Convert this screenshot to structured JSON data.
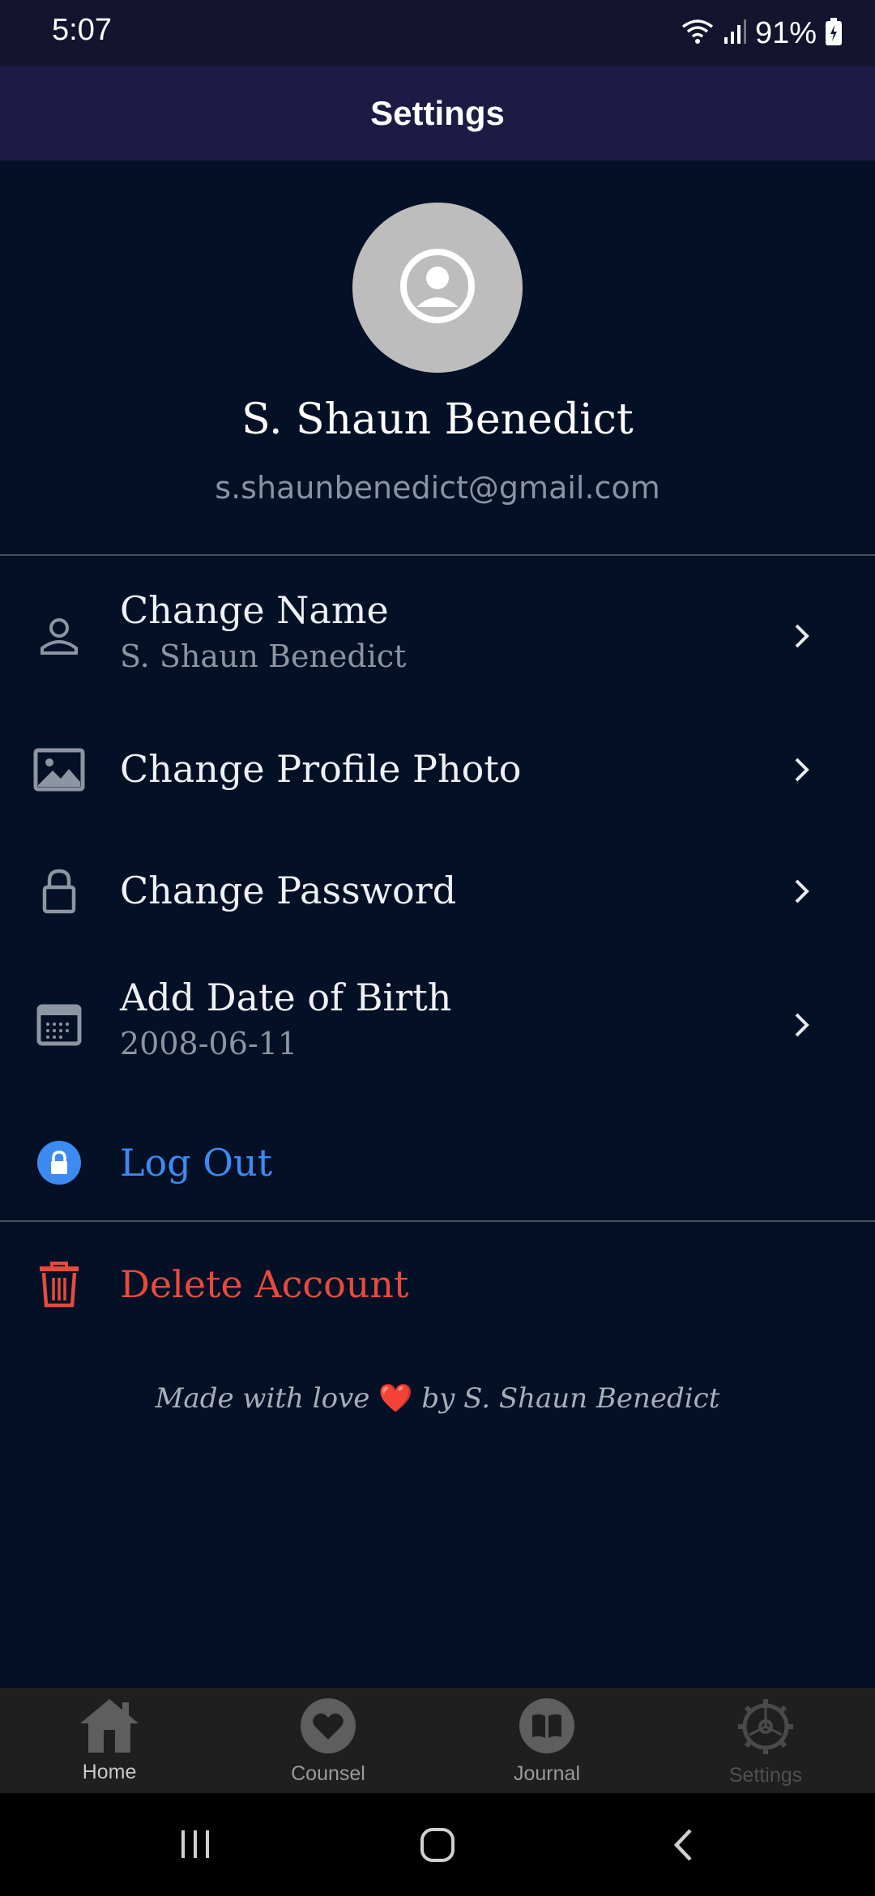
{
  "status_bar": {
    "time": "5:07",
    "battery": "91%"
  },
  "app_bar": {
    "title": "Settings"
  },
  "profile": {
    "name": "S. Shaun Benedict",
    "email": "s.shaunbenedict@gmail.com"
  },
  "settings": {
    "change_name": {
      "title": "Change Name",
      "value": "S. Shaun Benedict",
      "icon": "person-icon"
    },
    "change_photo": {
      "title": "Change Profile Photo",
      "icon": "image-icon"
    },
    "change_password": {
      "title": "Change Password",
      "icon": "lock-icon"
    },
    "date_of_birth": {
      "title": "Add Date of Birth",
      "value": "2008-06-11",
      "icon": "calendar-icon"
    },
    "log_out": {
      "title": "Log Out",
      "icon": "lock-circle-icon",
      "color": "#3d8bf2"
    },
    "delete_account": {
      "title": "Delete Account",
      "icon": "trash-icon",
      "color": "#e84a3c"
    }
  },
  "footer": {
    "text_before": "Made with love",
    "heart": "❤️",
    "text_after": "by S. Shaun Benedict"
  },
  "bottom_nav": {
    "items": [
      {
        "label": "Home",
        "icon": "home-icon"
      },
      {
        "label": "Counsel",
        "icon": "heart-icon"
      },
      {
        "label": "Journal",
        "icon": "book-icon"
      },
      {
        "label": "Settings",
        "icon": "gear-icon"
      }
    ],
    "active_color": "#9a9a9a",
    "inactive_color": "#5a5a5a"
  },
  "colors": {
    "background": "#041025",
    "app_bar": "#1d1b44",
    "status_bar": "#15142f"
  }
}
